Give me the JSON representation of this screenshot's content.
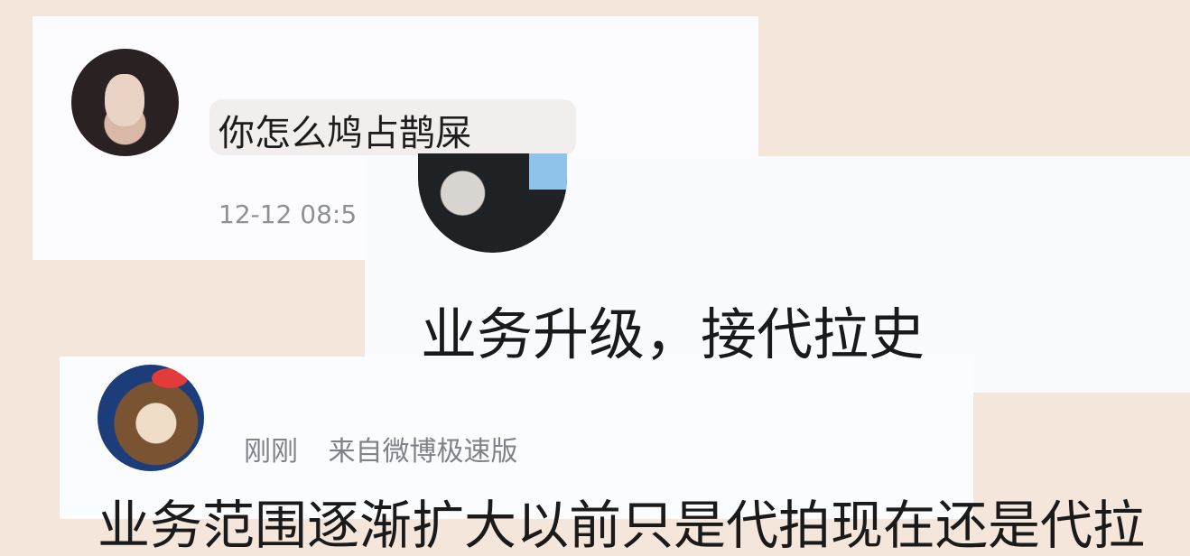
{
  "comments": [
    {
      "avatar": "user-avatar-woman",
      "text": "你怎么鸠占鹊屎",
      "time": "12-12 08:5"
    },
    {
      "avatar": "user-avatar-man",
      "text": "业务升级，接代拉史"
    },
    {
      "avatar": "user-avatar-anime",
      "time": "刚刚",
      "source": "来自微博极速版",
      "text": "业务范围逐渐扩大以前只是代拍现在还是代拉"
    }
  ],
  "colors": {
    "background": "#f4e6da",
    "card": "#fbfcfe",
    "text": "#1d1d1d",
    "meta": "#7f8288"
  }
}
